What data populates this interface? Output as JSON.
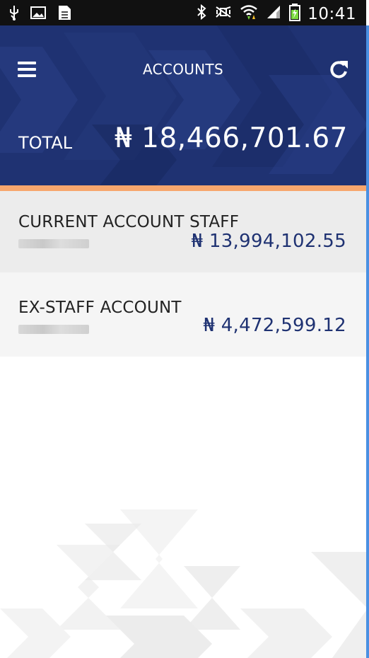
{
  "status_bar": {
    "time": "10:41",
    "icons": [
      "usb-icon",
      "image-icon",
      "clipboard-icon",
      "bluetooth-icon",
      "mute-icon",
      "wifi-icon",
      "signal-icon",
      "battery-charging-icon"
    ]
  },
  "header": {
    "title": "ACCOUNTS",
    "total_label": "TOTAL",
    "total_amount": "₦ 18,466,701.67",
    "menu_icon": "menu-icon",
    "refresh_icon": "refresh-icon"
  },
  "accounts": [
    {
      "name": "CURRENT ACCOUNT STAFF",
      "balance": "₦ 13,994,102.55"
    },
    {
      "name": "EX-STAFF ACCOUNT",
      "balance": "₦ 4,472,599.12"
    }
  ],
  "colors": {
    "header_bg": "#1f3272",
    "accent": "#f7a66d",
    "balance_text": "#1f3272"
  }
}
